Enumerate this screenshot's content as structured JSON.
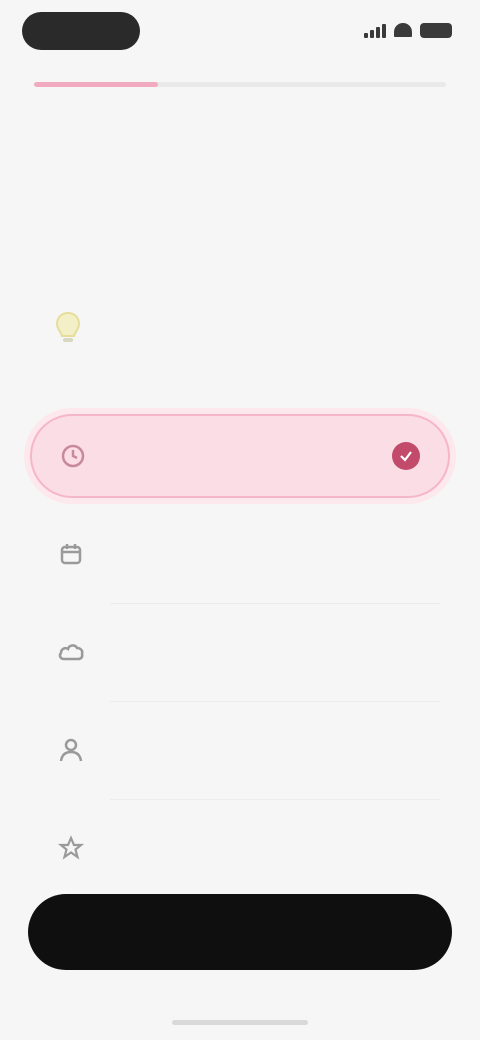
{
  "progress": {
    "fraction": 0.3
  },
  "question": {
    "title": ""
  },
  "hint": {
    "text": "",
    "icon": "lightbulb-icon"
  },
  "options": [
    {
      "label": "",
      "icon": "clock-icon",
      "selected": true
    },
    {
      "label": "",
      "icon": "calendar-icon",
      "selected": false
    },
    {
      "label": "",
      "icon": "cloud-icon",
      "selected": false
    },
    {
      "label": "",
      "icon": "person-icon",
      "selected": false
    },
    {
      "label": "",
      "icon": "star-icon",
      "selected": false
    }
  ],
  "footer": {
    "continue_label": ""
  },
  "colors": {
    "accent": "#c24a6b",
    "selected_bg": "#fbdde6",
    "button": "#0f0f0f"
  }
}
